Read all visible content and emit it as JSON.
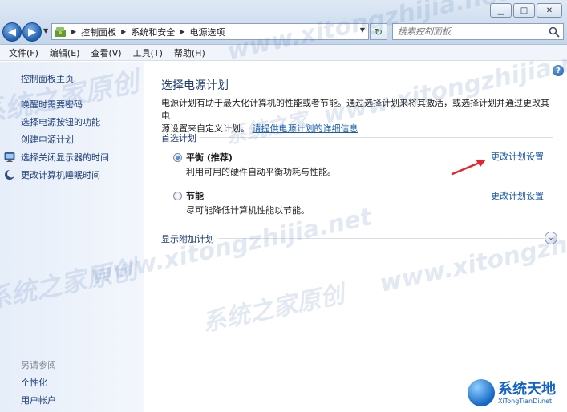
{
  "window": {
    "min_glyph": "▁",
    "max_glyph": "□",
    "close_glyph": "✕"
  },
  "nav": {
    "back_glyph": "◀",
    "forward_glyph": "▶",
    "dropdown_glyph": "▼"
  },
  "address": {
    "crumbs": [
      "控制面板",
      "系统和安全",
      "电源选项"
    ],
    "separator": "▶",
    "dropdown_glyph": "▼",
    "refresh_glyph": "↻"
  },
  "search": {
    "placeholder": "搜索控制面板"
  },
  "menu": {
    "items": [
      "文件(F)",
      "编辑(E)",
      "查看(V)",
      "工具(T)",
      "帮助(H)"
    ]
  },
  "sidebar": {
    "home": "控制面板主页",
    "links": [
      {
        "label": "唤醒时需要密码",
        "icon": "none"
      },
      {
        "label": "选择电源按钮的功能",
        "icon": "none"
      },
      {
        "label": "创建电源计划",
        "icon": "none"
      },
      {
        "label": "选择关闭显示器的时间",
        "icon": "monitor-icon"
      },
      {
        "label": "更改计算机睡眠时间",
        "icon": "moon-icon"
      }
    ],
    "see_also_label": "另请参阅",
    "see_also": [
      "个性化",
      "用户帐户"
    ]
  },
  "main": {
    "help_glyph": "?",
    "title": "选择电源计划",
    "desc_line1": "电源计划有助于最大化计算机的性能或者节能。通过选择计划来将其激活，或选择计划并通过更改其电",
    "desc_line2_prefix": "源设置来自定义计划。",
    "desc_link": "请提供电源计划的详细信息",
    "preferred_label": "首选计划",
    "plans": [
      {
        "name": "平衡 (推荐)",
        "desc": "利用可用的硬件自动平衡功耗与性能。",
        "link": "更改计划设置",
        "selected": true
      },
      {
        "name": "节能",
        "desc": "尽可能降低计算机性能以节能。",
        "link": "更改计划设置",
        "selected": false
      }
    ],
    "extra_label": "显示附加计划",
    "expand_glyph": "⌄"
  },
  "watermark": {
    "url": "www.xitongzhijia.net",
    "cn": "系统之家原创",
    "cn_short": "系统之家",
    "logo_cn": "系统天地",
    "logo_en": "XiTongTianDi.net"
  },
  "colors": {
    "accent_link": "#1a5aa8",
    "title": "#1e3b6e",
    "annotation_arrow": "#e8242a"
  }
}
